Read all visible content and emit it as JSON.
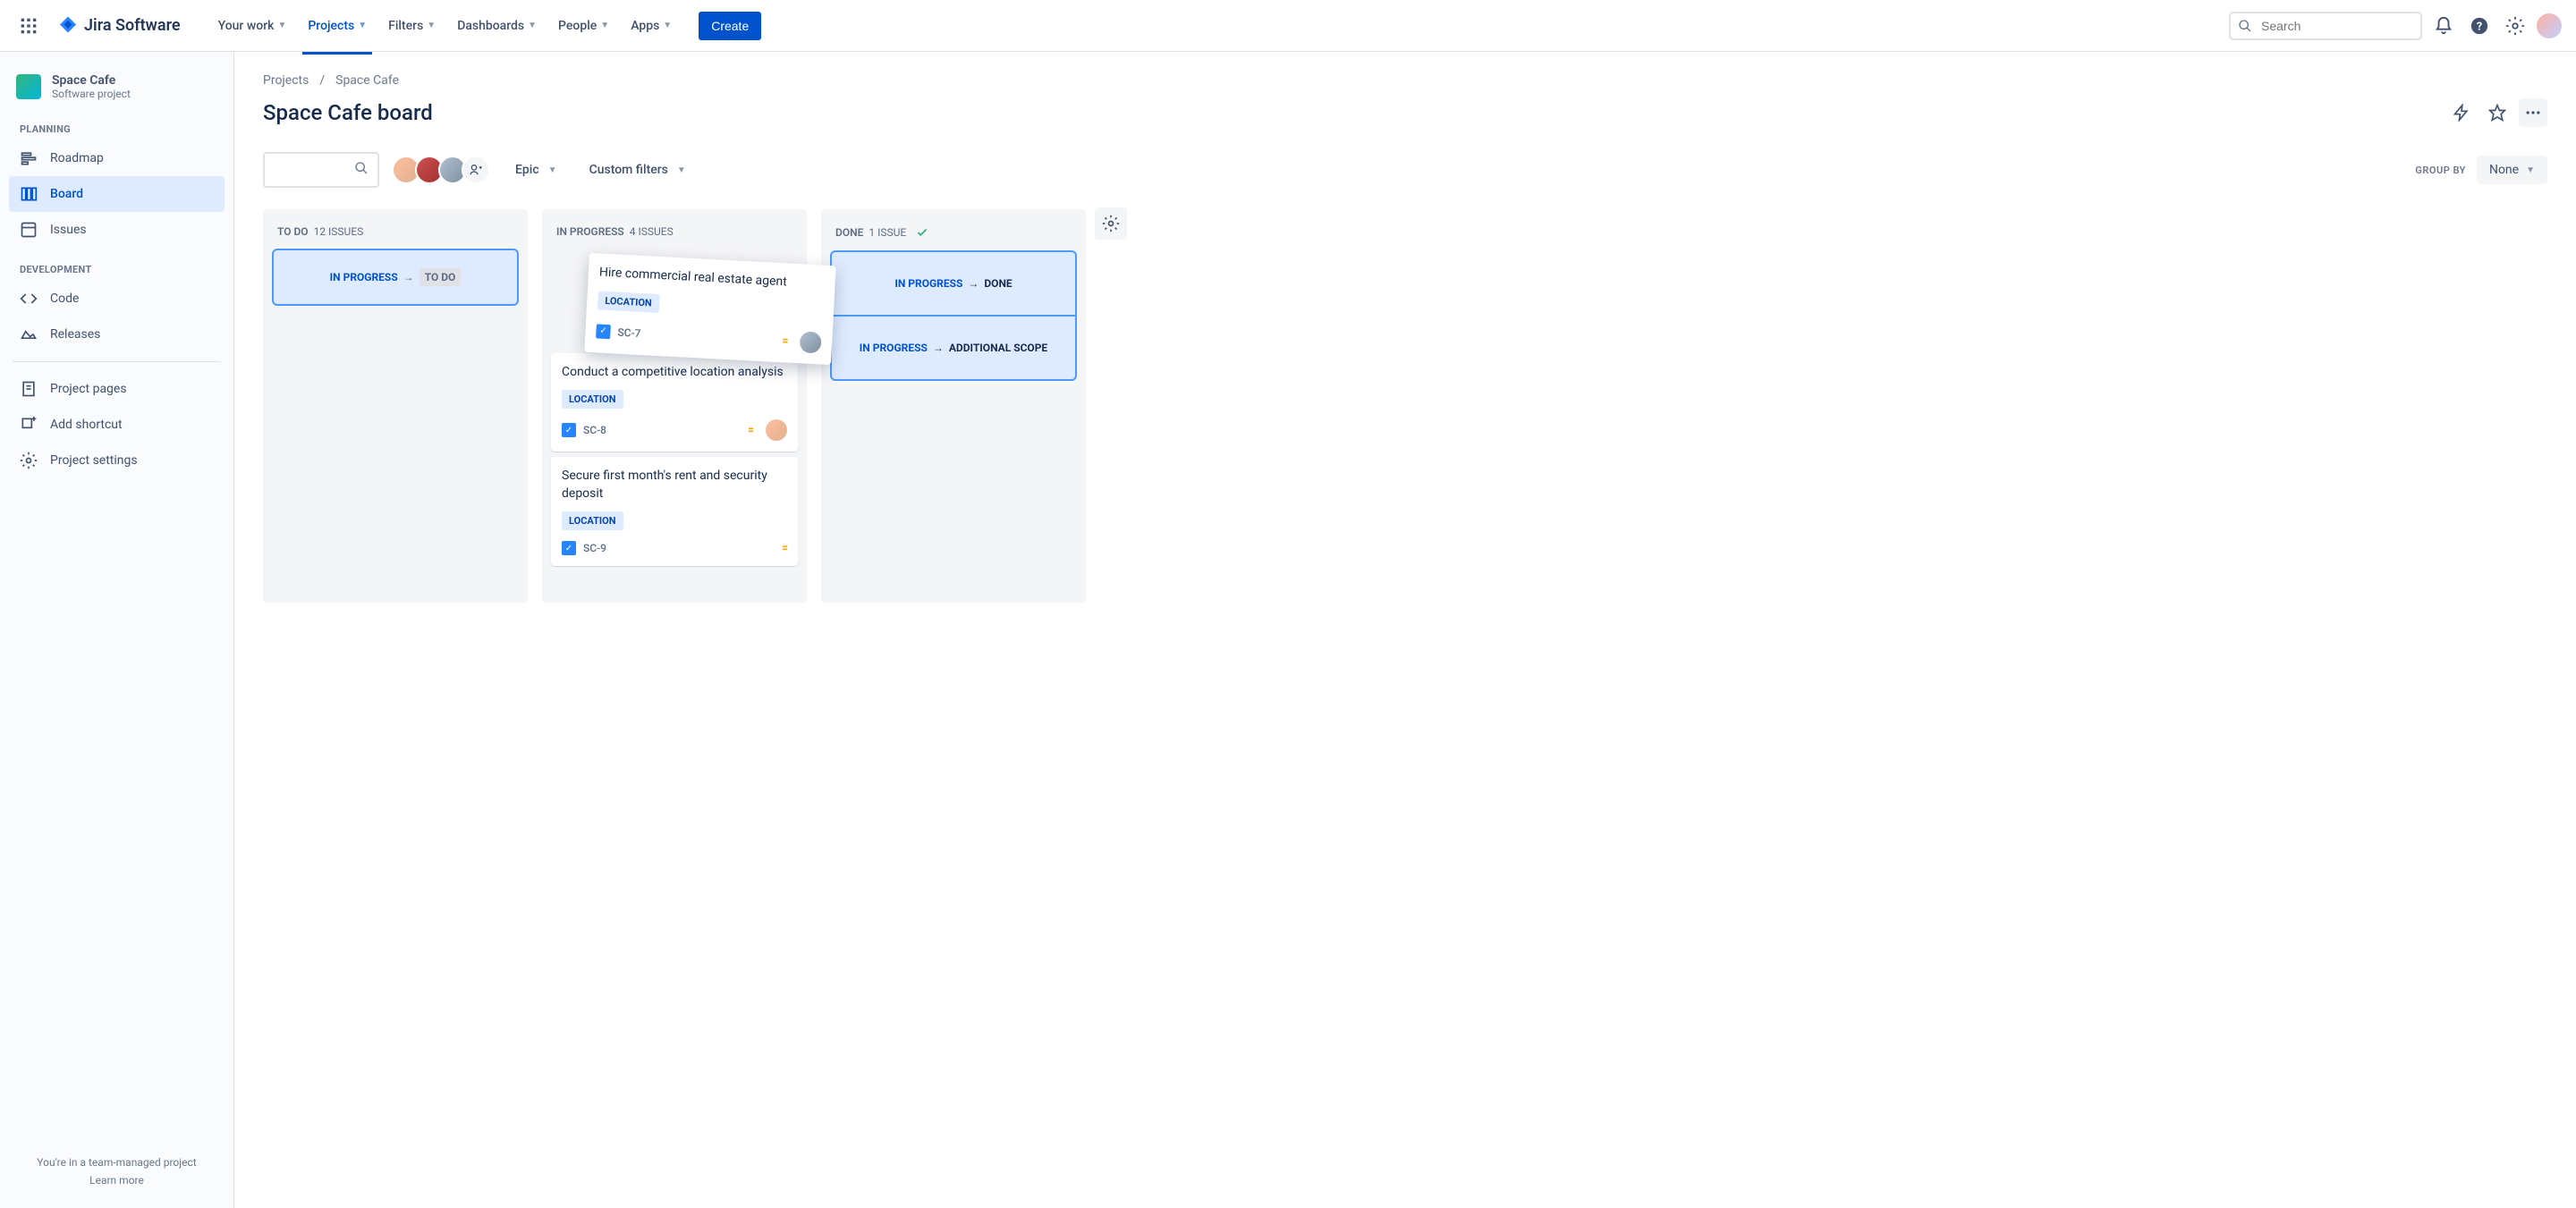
{
  "nav": {
    "logo": "Jira Software",
    "items": [
      "Your work",
      "Projects",
      "Filters",
      "Dashboards",
      "People",
      "Apps"
    ],
    "active_index": 1,
    "create": "Create",
    "search_placeholder": "Search"
  },
  "sidebar": {
    "project_name": "Space Cafe",
    "project_type": "Software project",
    "sections": {
      "planning": {
        "label": "PLANNING",
        "items": [
          "Roadmap",
          "Board",
          "Issues"
        ],
        "active_index": 1
      },
      "development": {
        "label": "DEVELOPMENT",
        "items": [
          "Code",
          "Releases"
        ]
      }
    },
    "bottom_items": [
      "Project pages",
      "Add shortcut",
      "Project settings"
    ],
    "footer_line": "You're in a team-managed project",
    "footer_link": "Learn more"
  },
  "breadcrumb": {
    "items": [
      "Projects",
      "Space Cafe"
    ]
  },
  "page_title": "Space Cafe board",
  "toolbar": {
    "filters": [
      "Epic",
      "Custom filters"
    ],
    "groupby_label": "GROUP BY",
    "groupby_value": "None"
  },
  "columns": [
    {
      "name": "TO DO",
      "count_text": "12 ISSUES",
      "dropzone": {
        "from": "IN PROGRESS",
        "to": "TO DO",
        "to_style": "todo"
      }
    },
    {
      "name": "IN PROGRESS",
      "count_text": "4 ISSUES",
      "cards": [
        {
          "title": "Hire commercial real estate agent",
          "tag": "LOCATION",
          "key": "SC-7",
          "dragging": true
        },
        {
          "title": "Conduct a competitive location analysis",
          "tag": "LOCATION",
          "key": "SC-8"
        },
        {
          "title": "Secure first month's rent and security deposit",
          "tag": "LOCATION",
          "key": "SC-9"
        }
      ]
    },
    {
      "name": "DONE",
      "count_text": "1 ISSUE",
      "check": true,
      "dropzones": [
        {
          "from": "IN PROGRESS",
          "to": "DONE",
          "to_style": "done"
        },
        {
          "from": "IN PROGRESS",
          "to": "ADDITIONAL SCOPE",
          "to_style": "scope"
        }
      ]
    }
  ]
}
